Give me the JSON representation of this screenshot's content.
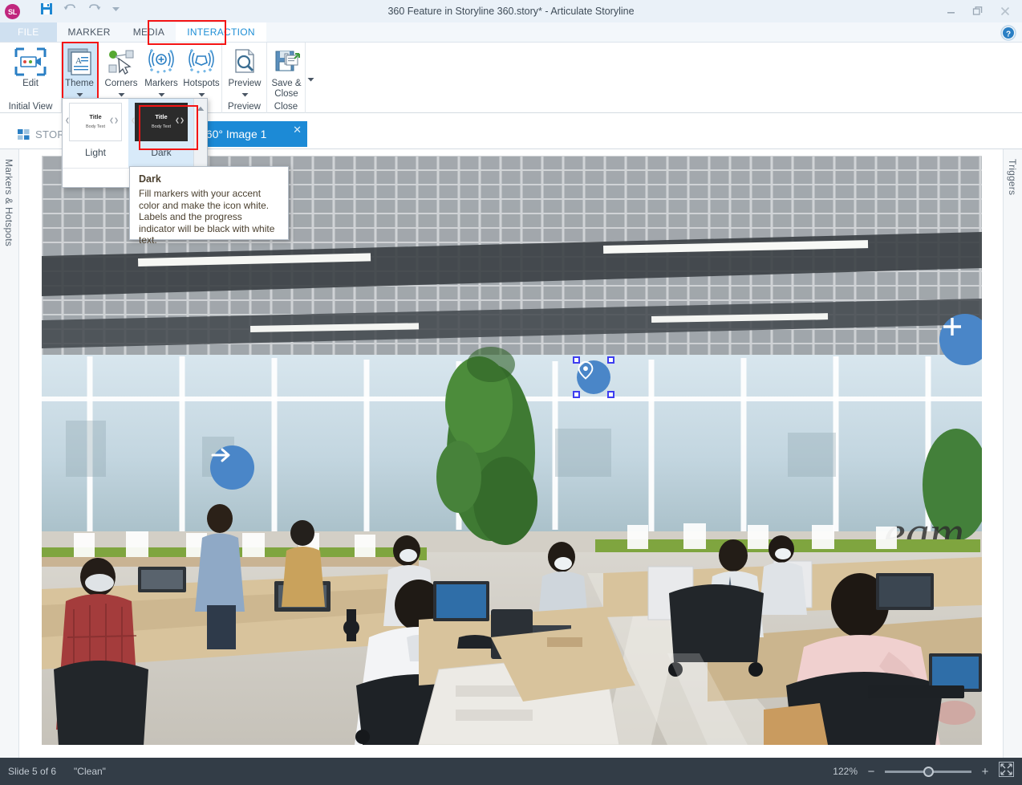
{
  "window": {
    "title": "360 Feature in Storyline 360.story*  -  Articulate Storyline",
    "logo_text": "SL",
    "quick_access": [
      "save-icon",
      "undo-icon",
      "redo-icon",
      "customize-qat-icon"
    ],
    "controls": [
      "minimize-icon",
      "restore-icon",
      "close-icon"
    ],
    "help_icon": "help-icon"
  },
  "ribbon": {
    "tabs": [
      {
        "label": "FILE",
        "active": false,
        "file": true
      },
      {
        "label": "MARKER",
        "active": false
      },
      {
        "label": "MEDIA",
        "active": false
      },
      {
        "label": "INTERACTION",
        "active": true
      }
    ],
    "groups": [
      {
        "name": "Initial View",
        "label": "Initial View",
        "buttons": [
          {
            "label": "Edit",
            "icon": "camera-view-icon",
            "caret": false
          }
        ]
      },
      {
        "name": "markers-hotspots",
        "label": "",
        "buttons": [
          {
            "label": "Theme",
            "icon": "theme-icon",
            "caret": true,
            "selected": true
          },
          {
            "label": "Corners",
            "icon": "corners-icon",
            "caret": true
          },
          {
            "label": "Markers",
            "icon": "markers-icon",
            "caret": true
          },
          {
            "label": "Hotspots",
            "icon": "hotspots-icon",
            "caret": true
          }
        ]
      },
      {
        "name": "Preview",
        "label": "Preview",
        "buttons": [
          {
            "label": "Preview",
            "icon": "preview-icon",
            "caret": true
          }
        ]
      },
      {
        "name": "Close",
        "label": "Close",
        "buttons": [
          {
            "label": "Save &\nClose",
            "icon": "save-close-icon",
            "caret": true
          }
        ]
      }
    ]
  },
  "theme_gallery": {
    "items": [
      {
        "name": "Light",
        "selected": false,
        "title": "Title",
        "body": "Body Text"
      },
      {
        "name": "Dark",
        "selected": true,
        "title": "Title",
        "body": "Body Text"
      }
    ],
    "scroll_up_icon": "scroll-up-icon"
  },
  "tooltip": {
    "title": "Dark",
    "body": "Fill markers with your accent color and make the icon white. Labels and the progress indicator will be black with white text."
  },
  "tabstrip": {
    "story_tab": {
      "label": "STORY",
      "icon": "story-view-icon"
    },
    "image_tab": {
      "label": "360° Image 1",
      "close_icon": "close-icon"
    },
    "devices": [
      {
        "name": "device-laptop",
        "icon": "laptop-icon"
      },
      {
        "name": "device-tablet-landscape",
        "icon": "tablet-landscape-icon"
      },
      {
        "name": "device-tablet-portrait",
        "icon": "tablet-portrait-icon"
      },
      {
        "name": "device-phone-landscape",
        "icon": "phone-landscape-icon"
      },
      {
        "name": "device-phone-portrait",
        "icon": "phone-portrait-icon"
      },
      {
        "name": "device-settings",
        "icon": "gear-icon"
      }
    ]
  },
  "rails": {
    "left_label": "Markers & Hotspots",
    "right_label": "Triggers"
  },
  "canvas": {
    "description": "360° office interior photo with open-plan desks, employees at computers, green partition panels, large windows and a grid ceiling",
    "accent_color": "#4a86c8",
    "markers": [
      {
        "name": "marker-pin",
        "icon": "map-pin-icon",
        "selected": true
      },
      {
        "name": "hotspot-plus",
        "icon": "plus-icon",
        "selected": false
      },
      {
        "name": "hotspot-arrow",
        "icon": "arrow-right-icon",
        "selected": false
      }
    ]
  },
  "statusbar": {
    "slide_count": "Slide 5 of 6",
    "scene_name": "\"Clean\"",
    "zoom_percent": "122%",
    "zoom_minus": "−",
    "zoom_plus": "+",
    "fit_icon": "fit-to-window-icon"
  }
}
